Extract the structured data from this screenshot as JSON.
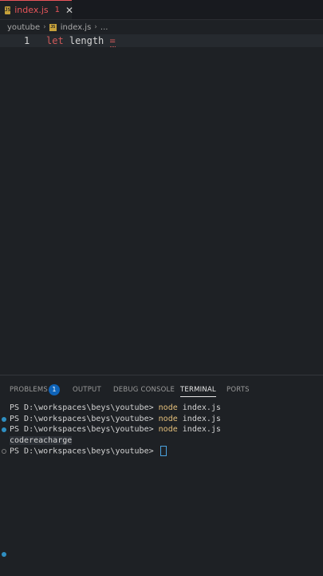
{
  "tab": {
    "label": "index.js",
    "problems_count": "1",
    "close": "✕",
    "icon": "js-file-icon",
    "icon_text": "JS"
  },
  "breadcrumb": {
    "folder": "youtube",
    "file": "index.js",
    "more": "..."
  },
  "editor": {
    "line_number": "1",
    "keyword": "let",
    "identifier": "length",
    "operator": "="
  },
  "panel": {
    "tabs": [
      "PROBLEMS",
      "OUTPUT",
      "DEBUG CONSOLE",
      "TERMINAL",
      "PORTS"
    ],
    "problems_badge": "1",
    "active_tab": "TERMINAL"
  },
  "terminal": {
    "prompt": "PS D:\\workspaces\\beys\\youtube>",
    "cmd": "node",
    "arg": "index.js",
    "output": "codereacharge"
  },
  "colors": {
    "accent_error": "#e8555a",
    "badge_blue": "#0e63b8",
    "command_yellow": "#e5c07b"
  }
}
